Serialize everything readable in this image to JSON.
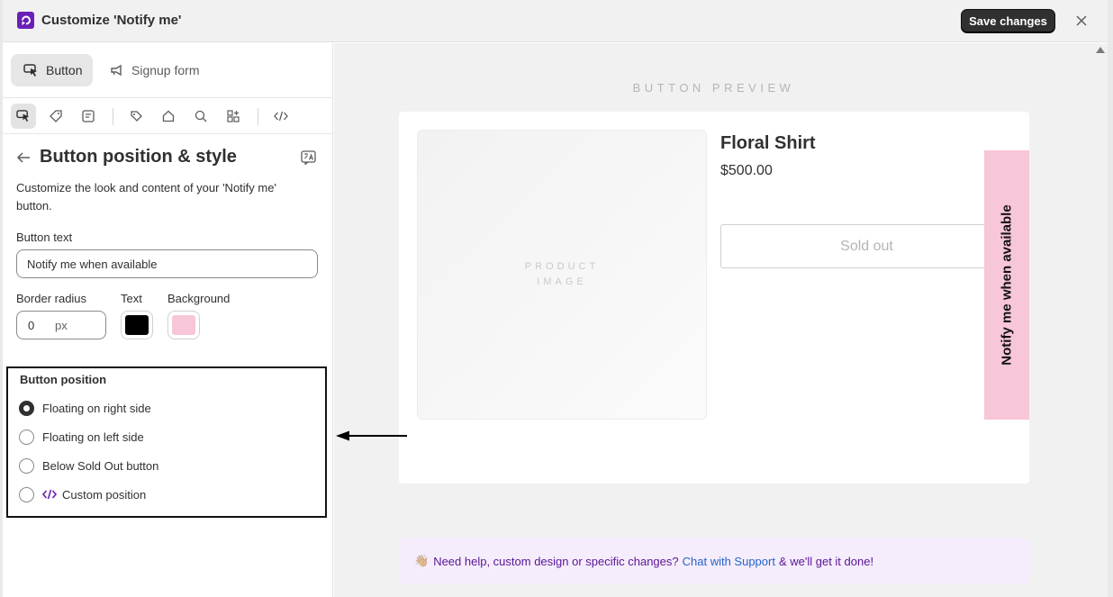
{
  "header": {
    "title": "Customize 'Notify me'",
    "save_label": "Save changes"
  },
  "sidebar": {
    "tabs": [
      {
        "label": "Button",
        "icon": "cursor-click-icon",
        "active": true
      },
      {
        "label": "Signup form",
        "icon": "megaphone-icon",
        "active": false
      }
    ],
    "icon_toolbar": [
      "cursor-click-icon",
      "tag-icon",
      "note-icon",
      "price-tag-icon",
      "home-icon",
      "search-icon",
      "apps-icon",
      "code-icon"
    ],
    "section": {
      "title": "Button position & style",
      "description": "Customize the look and content of your 'Notify me' button."
    },
    "button_text": {
      "label": "Button text",
      "value": "Notify me when available"
    },
    "border_radius": {
      "label": "Border radius",
      "value": "0",
      "unit": "px"
    },
    "text_color": {
      "label": "Text",
      "value": "#000000"
    },
    "background_color": {
      "label": "Background",
      "value": "#f8c6d9"
    },
    "position": {
      "title": "Button position",
      "options": [
        {
          "label": "Floating on right side",
          "checked": true
        },
        {
          "label": "Floating on left side",
          "checked": false
        },
        {
          "label": "Below Sold Out button",
          "checked": false
        },
        {
          "label": "Custom position",
          "checked": false
        }
      ]
    }
  },
  "preview": {
    "label": "BUTTON PREVIEW",
    "product_image_label": "PRODUCT IMAGE",
    "product_name": "Floral Shirt",
    "price": "$500.00",
    "sold_out_label": "Sold out",
    "notify_label": "Notify me when available",
    "help": {
      "emoji": "👋🏼",
      "text_before": "Need help, custom design or specific changes?",
      "link": "Chat with Support",
      "text_after": "& we'll get it done!"
    }
  },
  "colors": {
    "accent_purple": "#6a1fb8",
    "notify_bg": "#f8c6d9",
    "link_blue": "#2563c9"
  }
}
